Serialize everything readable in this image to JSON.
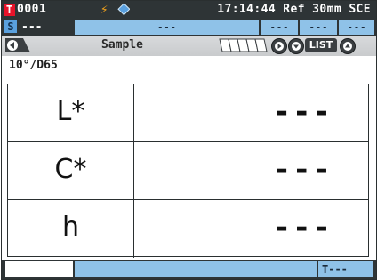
{
  "statusbar": {
    "target_badge": "T",
    "target_number": "0001",
    "status_text": "17:14:44 Ref 30mm SCE",
    "icons": [
      "bolt-icon",
      "link-icon"
    ]
  },
  "secondary_row": {
    "sample_badge": "S",
    "sample_value": "---",
    "box1": "---",
    "box2": "---",
    "box3": "---",
    "box4": "---"
  },
  "nav": {
    "title": "Sample",
    "list_label": "LIST"
  },
  "observer": "10°/D65",
  "table": {
    "rows": [
      {
        "label": "L*",
        "value": "---"
      },
      {
        "label": "C*",
        "value": "---"
      },
      {
        "label": "h",
        "value": "---"
      }
    ]
  },
  "bottombar": {
    "tolerance": "T---"
  },
  "colors": {
    "accent_red": "#e8132a",
    "accent_blue": "#8fc2e8",
    "bar_dark": "#2e3436",
    "bolt_orange": "#f2a21b"
  }
}
